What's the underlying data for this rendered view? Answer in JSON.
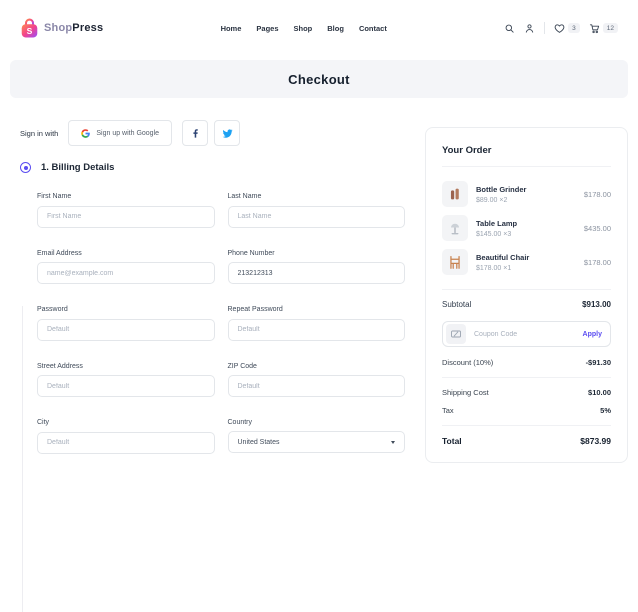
{
  "header": {
    "logo": {
      "shop": "Shop",
      "press": "Press"
    },
    "nav": [
      "Home",
      "Pages",
      "Shop",
      "Blog",
      "Contact"
    ],
    "wishlist_count": "3",
    "cart_count": "12",
    "icons": [
      "search-icon",
      "user-icon",
      "heart-icon",
      "cart-icon"
    ]
  },
  "banner": {
    "title": "Checkout"
  },
  "signin": {
    "label": "Sign in with",
    "google_label": "Sign up with Google",
    "icons": [
      "google-icon",
      "facebook-icon",
      "twitter-icon"
    ]
  },
  "billing": {
    "step_title": "1. Billing Details",
    "rows": [
      [
        {
          "label": "First Name",
          "placeholder": "First Name"
        },
        {
          "label": "Last Name",
          "placeholder": "Last Name"
        }
      ],
      [
        {
          "label": "Email Address",
          "placeholder": "name@example.com"
        },
        {
          "label": "Phone Number",
          "value": "213212313"
        }
      ],
      [
        {
          "label": "Password",
          "placeholder": "Default"
        },
        {
          "label": "Repeat Password",
          "placeholder": "Default"
        }
      ],
      [
        {
          "label": "Street Address",
          "placeholder": "Default"
        },
        {
          "label": "ZIP Code",
          "placeholder": "Default"
        }
      ],
      [
        {
          "label": "City",
          "placeholder": "Default"
        },
        {
          "label": "Country",
          "value": "United States"
        }
      ]
    ]
  },
  "order": {
    "title": "Your Order",
    "items": [
      {
        "name": "Bottle Grinder",
        "price_line": "$89.00 ×2",
        "total": "$178.00",
        "thumb": "bottles-icon"
      },
      {
        "name": "Table Lamp",
        "price_line": "$145.00 ×3",
        "total": "$435.00",
        "thumb": "lamp-icon"
      },
      {
        "name": "Beautiful Chair",
        "price_line": "$178.00 ×1",
        "total": "$178.00",
        "thumb": "chair-icon"
      }
    ],
    "subtotal_label": "Subtotal",
    "subtotal_value": "$913.00",
    "coupon": {
      "placeholder": "Coupon Code",
      "apply_label": "Apply",
      "icon": "ticket-icon"
    },
    "discount_label": "Discount (10%)",
    "discount_value": "-$91.30",
    "shipping_label": "Shipping Cost",
    "shipping_value": "$10.00",
    "tax_label": "Tax",
    "tax_value": "5%",
    "total_label": "Total",
    "total_value": "$873.99"
  },
  "colors": {
    "accent": "#5b4df1",
    "banner_bg": "#f4f5f8",
    "facebook": "#2d4373",
    "twitter": "#1da1f2",
    "logo_gradient": [
      "#ff8a4c",
      "#f2438c",
      "#9b4dfa"
    ],
    "muted_text": "#9aa3b0",
    "border": "#e3e6ea"
  }
}
